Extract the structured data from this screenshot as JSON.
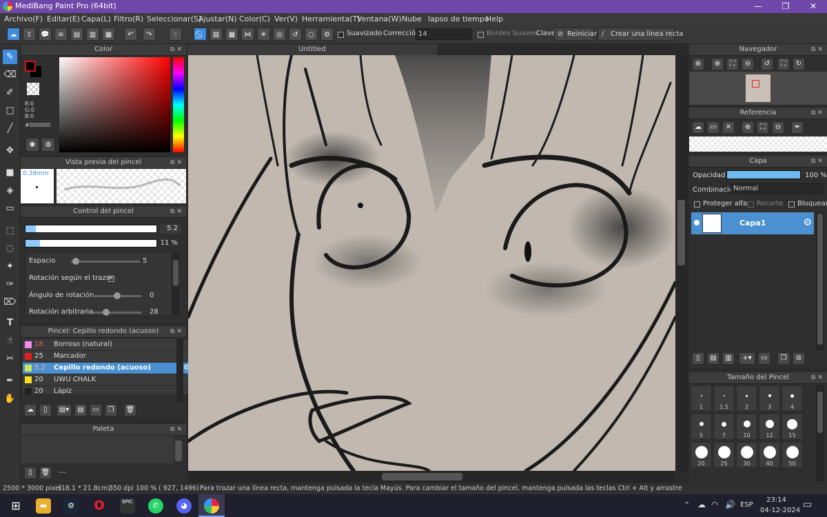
{
  "window": {
    "title": "MediBang Paint Pro (64bit)",
    "minimize": "—",
    "restore": "❐",
    "close": "✕"
  },
  "menu": [
    "Archivo(F)",
    "Editar(E)",
    "Capa(L)",
    "Filtro(R)",
    "Seleccionar(S)",
    "Ajustar(N)",
    "Color(C)",
    "Ver(V)",
    "Herramienta(T)",
    "Ventana(W)",
    "Nube",
    "lapso de tiempo",
    "Help"
  ],
  "toolbar": {
    "smoothing_label": "Suavizado",
    "correction_label": "Corrección",
    "correction_value": "14",
    "soft_edges_label": "Bordes Suaves",
    "key_label": "Clave",
    "reset_label": "Reiniciar",
    "straight_line_label": "Crear una línea recta"
  },
  "color_panel": {
    "title": "Color",
    "r": "R:0",
    "g": "G:0",
    "b": "B:0",
    "hex": "#000000",
    "fg_color": "#000000"
  },
  "brush_preview": {
    "title": "Vista previa del pincel",
    "size": "0.38mm"
  },
  "brush_control": {
    "title": "Control del pincel",
    "size_value": "5.2",
    "size_fraction": 0.08,
    "opacity_value": "11 %",
    "opacity_fraction": 0.11,
    "spacing_label": "Espacio",
    "spacing_value": "5",
    "rotation_follow_label": "Rotación según el trazo",
    "rotation_angle_label": "Ángulo de rotación",
    "rotation_angle_value": "0",
    "random_rotation_label": "Rotación arbitraria",
    "random_rotation_value": "28"
  },
  "brush_list": {
    "title": "Pincel: Cepillo redondo (acuoso)",
    "items": [
      {
        "size": "18",
        "name": "Borroso (natural)",
        "color": "#f08af0"
      },
      {
        "size": "25",
        "name": "Marcador",
        "color": "#e02020"
      },
      {
        "size": "5.2",
        "name": "Cepillo redondo (acuoso)",
        "color": "#c8e85a"
      },
      {
        "size": "20",
        "name": "UWU CHALK",
        "color": "#f0e020"
      },
      {
        "size": "20",
        "name": "Lápiz",
        "color": "#202020"
      }
    ]
  },
  "palette": {
    "title": "Paleta",
    "footer": "---"
  },
  "document": {
    "tab": "Untitled"
  },
  "navigator": {
    "title": "Navegador"
  },
  "reference": {
    "title": "Referencia"
  },
  "layer_panel": {
    "title": "Capa",
    "opacity_label": "Opacidad",
    "opacity_value": "100 %",
    "blend_label": "Combinación",
    "blend_value": "Normal",
    "protect_alpha": "Proteger alfa",
    "clip": "Recorte",
    "lock": "Bloquear",
    "layer_name": "Capa1"
  },
  "brush_size_panel": {
    "title": "Tamaño del Pincel",
    "sizes": [
      "1",
      "1.5",
      "2",
      "3",
      "4",
      "5",
      "7",
      "10",
      "12",
      "15",
      "20",
      "25",
      "30",
      "40",
      "50"
    ]
  },
  "status": {
    "dimensions": "2500 * 3000 pixel",
    "physical": "(18.1 * 21.8cm)",
    "dpi": "350 dpi",
    "zoom": "100 %",
    "coords": "( 927, 1496)",
    "hint": "Para trazar una línea recta, mantenga pulsada la tecla Mayús. Para cambiar el tamaño del pincel, mantenga pulsada las teclas Ctrl + Alt y arrastre"
  },
  "taskbar": {
    "lang": "ESP",
    "time": "23:14",
    "date": "04-12-2024"
  }
}
